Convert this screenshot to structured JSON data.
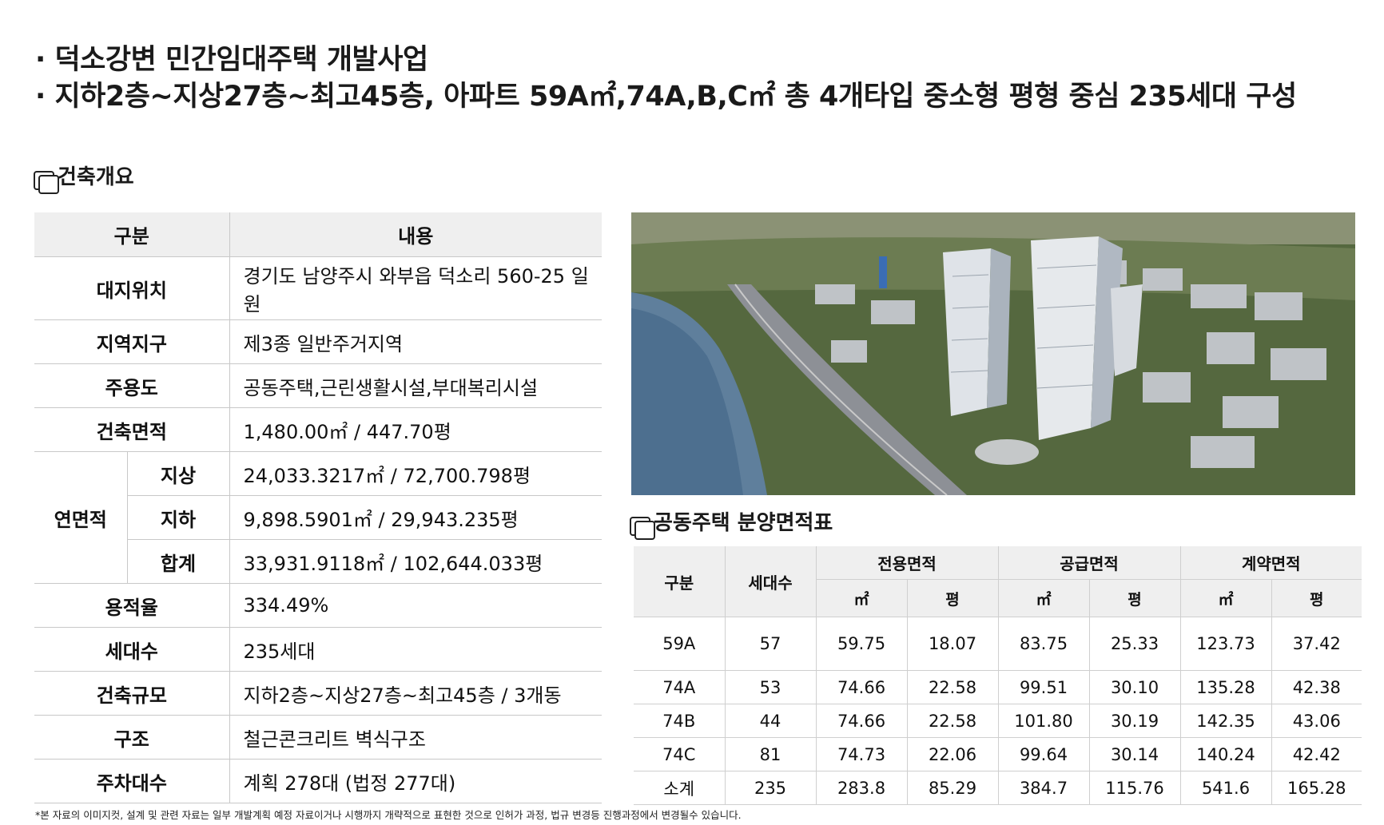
{
  "headline": {
    "line1": "· 덕소강변 민간임대주택 개발사업",
    "line2": "· 지하2층~지상27층~최고45층, 아파트 59A㎡,74A,B,C㎡ 총 4개타입 중소형 평형 중심 235세대 구성"
  },
  "overview": {
    "title": "건축개요",
    "header": {
      "key": "구분",
      "value": "내용"
    },
    "rows": [
      {
        "key": "대지위치",
        "value": "경기도 남양주시 와부읍 덕소리 560-25 일원"
      },
      {
        "key": "지역지구",
        "value": "제3종 일반주거지역"
      },
      {
        "key": "주용도",
        "value": "공동주택,근린생활시설,부대복리시설"
      },
      {
        "key": "건축면적",
        "value": "1,480.00㎡ / 447.70평"
      }
    ],
    "floor_area": {
      "key": "연면적",
      "rows": [
        {
          "sub": "지상",
          "value": "24,033.3217㎡ / 72,700.798평"
        },
        {
          "sub": "지하",
          "value": "9,898.5901㎡ / 29,943.235평"
        },
        {
          "sub": "합계",
          "value": "33,931.9118㎡ / 102,644.033평"
        }
      ]
    },
    "rows2": [
      {
        "key": "용적율",
        "value": "334.49%"
      },
      {
        "key": "세대수",
        "value": "235세대"
      },
      {
        "key": "건축규모",
        "value": "지하2층~지상27층~최고45층 / 3개동"
      },
      {
        "key": "구조",
        "value": "철근콘크리트 벽식구조"
      },
      {
        "key": "주차대수",
        "value": "계획 278대 (법정 277대)"
      }
    ]
  },
  "area_table": {
    "title": "공동주택 분양면적표",
    "header": {
      "type": "구분",
      "units": "세대수",
      "exclusive": "전용면적",
      "supply": "공급면적",
      "contract": "계약면적",
      "sqm": "㎡",
      "pyeong": "평"
    },
    "rows": [
      [
        "59A",
        "57",
        "59.75",
        "18.07",
        "83.75",
        "25.33",
        "123.73",
        "37.42"
      ],
      [
        "74A",
        "53",
        "74.66",
        "22.58",
        "99.51",
        "30.10",
        "135.28",
        "42.38"
      ],
      [
        "74B",
        "44",
        "74.66",
        "22.58",
        "101.80",
        "30.19",
        "142.35",
        "43.06"
      ],
      [
        "74C",
        "81",
        "74.73",
        "22.06",
        "99.64",
        "30.14",
        "140.24",
        "42.42"
      ],
      [
        "소계",
        "235",
        "283.8",
        "85.29",
        "384.7",
        "115.76",
        "541.6",
        "165.28"
      ]
    ]
  },
  "footnote": "*본 자료의 이미지컷, 설계 및 관련 자료는 일부 개발계획 예정 자료이거나 시행까지 개략적으로 표현한 것으로 인허가 과정, 법규 변경등 진행과정에서 변경될수 있습니다."
}
